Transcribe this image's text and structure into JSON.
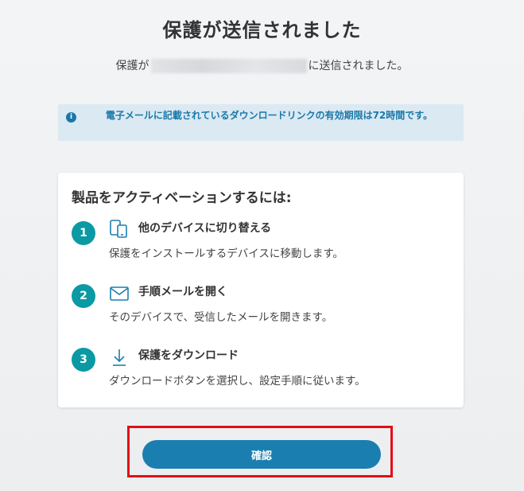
{
  "header": {
    "title": "保護が送信されました",
    "sent_prefix": "保護が",
    "sent_suffix": "に送信されました。"
  },
  "info": {
    "icon": "info-icon",
    "text": "電子メールに記載されているダウンロードリンクの有効期限は72時間です。"
  },
  "card": {
    "title": "製品をアクティベーションするには:",
    "steps": [
      {
        "number": "1",
        "icon": "devices-icon",
        "title": "他のデバイスに切り替える",
        "desc": "保護をインストールするデバイスに移動します。"
      },
      {
        "number": "2",
        "icon": "mail-icon",
        "title": "手順メールを開く",
        "desc": "そのデバイスで、受信したメールを開きます。"
      },
      {
        "number": "3",
        "icon": "download-icon",
        "title": "保護をダウンロード",
        "desc": "ダウンロードボタンを選択し、設定手順に従います。"
      }
    ]
  },
  "actions": {
    "confirm_label": "確認"
  },
  "colors": {
    "accent": "#1a7fb0",
    "step_badge": "#0b9aa3",
    "highlight": "#e30d16"
  }
}
